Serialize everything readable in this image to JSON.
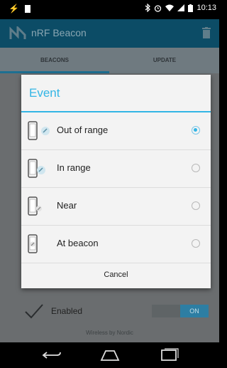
{
  "status_bar": {
    "time": "10:13"
  },
  "app": {
    "title": "nRF Beacon"
  },
  "tabs": [
    {
      "label": "BEACONS"
    },
    {
      "label": "UPDATE"
    }
  ],
  "dialog": {
    "title": "Event",
    "options": [
      {
        "label": "Out of range",
        "checked": true
      },
      {
        "label": "In range",
        "checked": false
      },
      {
        "label": "Near",
        "checked": false
      },
      {
        "label": "At beacon",
        "checked": false
      }
    ],
    "cancel_label": "Cancel"
  },
  "background": {
    "enabled_label": "Enabled",
    "toggle_label": "ON",
    "footer": "Wireless by Nordic"
  },
  "colors": {
    "accent": "#33b5e5",
    "app_bar": "#0c4c66"
  }
}
